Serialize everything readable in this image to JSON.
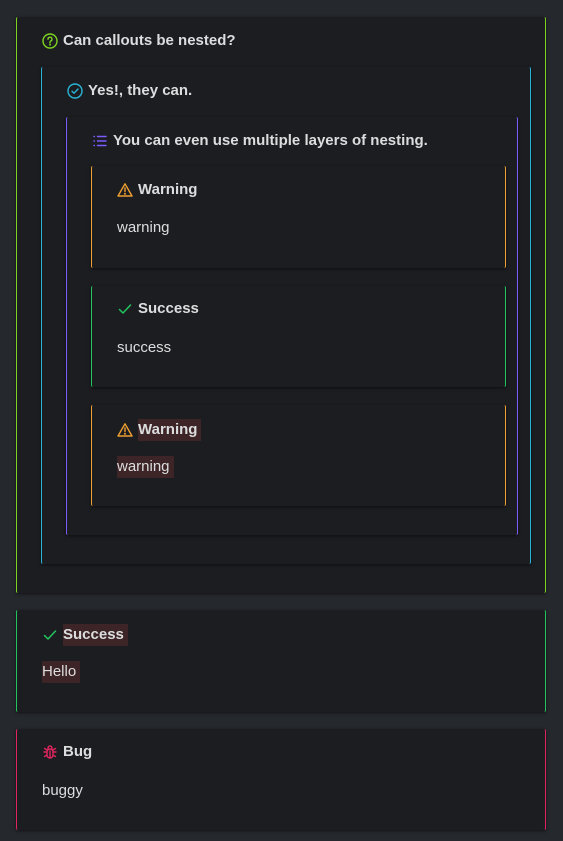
{
  "colors": {
    "background": "#25282d",
    "callout_bg": "#1b1d21",
    "question": "#7ed321",
    "success": "#22c55e",
    "info_nested": "#29b6d6",
    "list": "#7c5cff",
    "warning": "#f0a030",
    "bug": "#e0245e",
    "highlight": "#3d2527"
  },
  "callouts": {
    "outer": {
      "icon": "question-circle-icon",
      "title": "Can callouts be nested?"
    },
    "level2": {
      "icon": "check-circle-icon",
      "title": "Yes!, they can."
    },
    "level3": {
      "icon": "list-icon",
      "title": "You can even use multiple layers of nesting."
    },
    "warning1": {
      "icon": "warning-triangle-icon",
      "title": "Warning",
      "body": "warning"
    },
    "success1": {
      "icon": "check-icon",
      "title": "Success",
      "body": "success"
    },
    "warning2": {
      "icon": "warning-triangle-icon",
      "title": "Warning",
      "body": "warning"
    },
    "success2": {
      "icon": "check-icon",
      "title": "Success",
      "body": "Hello"
    },
    "bug": {
      "icon": "bug-icon",
      "title": "Bug",
      "body": "buggy"
    }
  }
}
